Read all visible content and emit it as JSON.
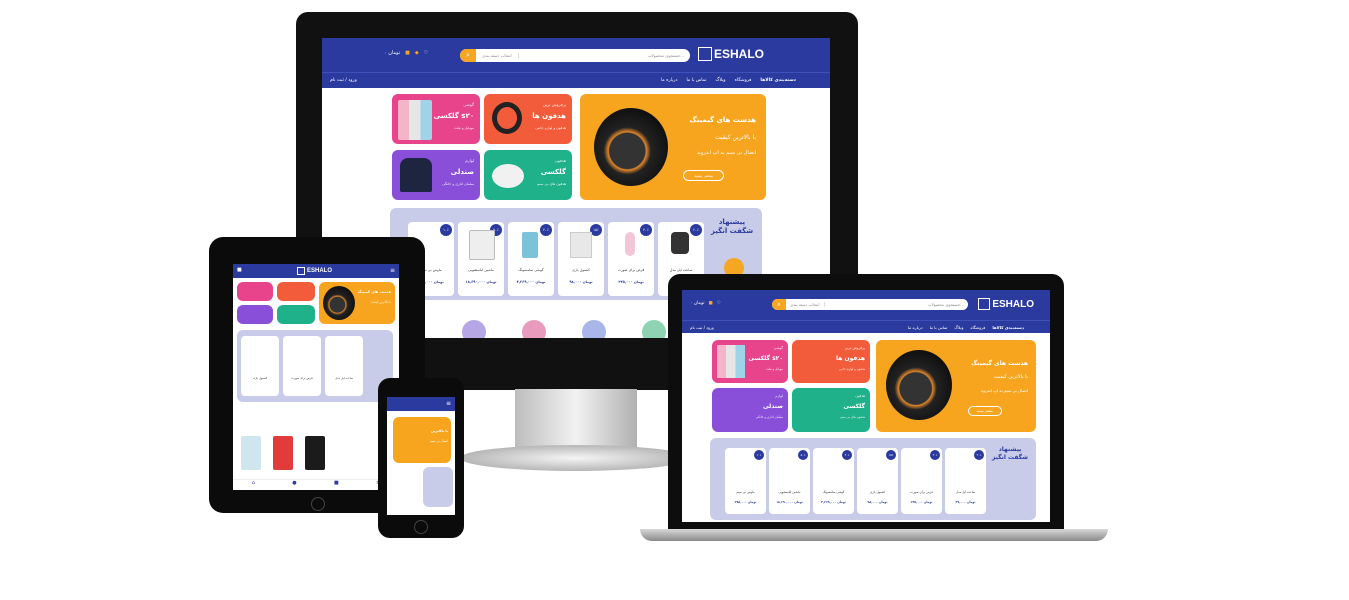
{
  "brand": {
    "name": "ESHALO",
    "primary": "#2b3a9e",
    "accent": "#f5a623"
  },
  "search": {
    "placeholder": "جستجوی محصولات...",
    "category": "انتخاب دسته بندی"
  },
  "header": {
    "cart_label": "۰ تومان"
  },
  "nav": {
    "categories": "دسته‌بندی کالاها",
    "items": [
      "فروشگاه",
      "وبلاگ",
      "تماس با ما",
      "درباره ما"
    ],
    "login": "ورود / ثبت نام"
  },
  "hero": {
    "title": "هدست های گیمینگ",
    "subtitle": "با بالاترین کیفیت",
    "desc": "اتصال بی سیم به اپ اندروید",
    "button": "بیشتر ببینید"
  },
  "tiles": [
    {
      "tag": "پرفروش ترین",
      "title": "هدفون ها",
      "sub": "هدفون و لوازم جانبی",
      "color": "#f25c3b"
    },
    {
      "tag": "گوشی",
      "title": "گلکسی s۲۰",
      "sub": "موبایل و تبلت",
      "color": "#e8448c"
    },
    {
      "tag": "هدفون",
      "title": "گلکسی",
      "sub": "هدفون های بی سیم",
      "color": "#1fb18a"
    },
    {
      "tag": "لوازم",
      "title": "صندلی",
      "sub": "مبلمان اداری و خانگی",
      "color": "#8a4fd8"
    }
  ],
  "offer": {
    "title": "پیشنهاد شگفت انگیز"
  },
  "products": [
    {
      "name": "ساعت اپل مدل",
      "price": "۳۹,۰۰۰ تومان",
      "discount": "۲۰٪"
    },
    {
      "name": "قرص برای صورت",
      "price": "۲۴۵,۰۰۰ تومان",
      "discount": "۳۰٪"
    },
    {
      "name": "کنسول بازی",
      "price": "۹۸,۰۰۰ تومان",
      "discount": "۱۵٪"
    },
    {
      "name": "گوشی سامسونگ",
      "price": "۴,۲۶۹,۰۰۰ تومان",
      "discount": "۴۰٪"
    },
    {
      "name": "ماشین لباسشویی",
      "price": "۱۸,۶۹۰,۰۰۰ تومان",
      "discount": "۵۰٪"
    },
    {
      "name": "ماوس بی سیم",
      "price": "۳۹۸,۰۰۰ تومان",
      "discount": "۱۰٪"
    }
  ],
  "phone": {
    "hero_line1": "با بالاترین",
    "hero_line2": "اتصال بی سیم"
  },
  "icons": [
    "cart-icon",
    "user-icon",
    "heart-icon",
    "menu-icon",
    "search-icon",
    "home-icon"
  ]
}
